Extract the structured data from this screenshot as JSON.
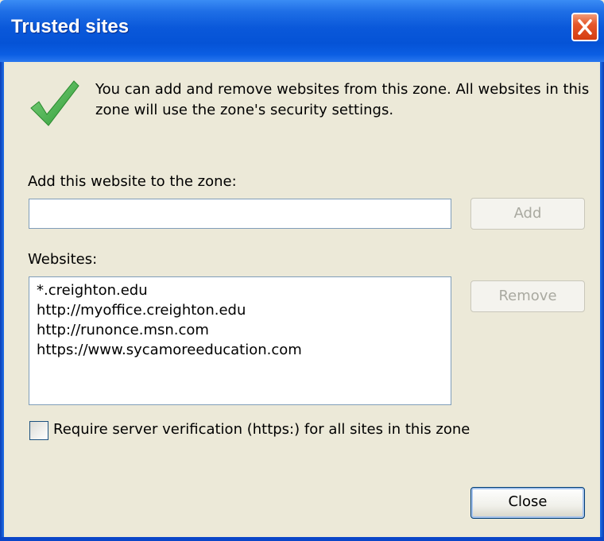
{
  "window": {
    "title": "Trusted sites"
  },
  "intro": {
    "text": "You can add and remove websites from this zone. All websites in this zone will use the zone's security settings.",
    "icon": "checkmark-icon"
  },
  "add_section": {
    "label": "Add this website to the zone:",
    "input_value": "",
    "add_button_label": "Add"
  },
  "websites_section": {
    "label": "Websites:",
    "items": [
      "*.creighton.edu",
      "http://myoffice.creighton.edu",
      "http://runonce.msn.com",
      "https://www.sycamoreeducation.com"
    ],
    "remove_button_label": "Remove"
  },
  "verification": {
    "label": "Require server verification (https:) for all sites in this zone",
    "checked": false
  },
  "footer": {
    "close_button_label": "Close"
  },
  "colors": {
    "title_bar": "#0a58da",
    "dialog_bg": "#ece9d8",
    "close_button": "#e5572a",
    "check_green": "#3aa83a"
  }
}
